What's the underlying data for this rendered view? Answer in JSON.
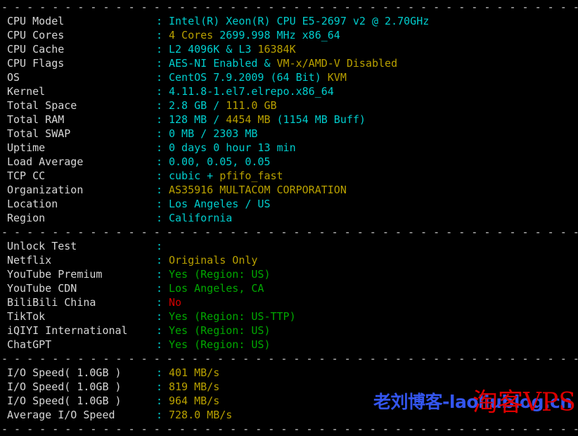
{
  "terminal": {
    "separator_top": "- - - - - - - - - - - - - - - - - - - - - - - - - - - - - - - - - - - - - - - - - - - - - - - - - - - - - - - - - - - - - - - - - - - - - - - - - - - - - - - - - - - -",
    "separator_mid": "- - - - - - - - - - - - - - - - - - - - - - - - - - - - - - - - - - - - - - - - - - - - - - - - - - - - - - - - - - - - - - - - - - - - - - - - - - - - - - - - - - - -",
    "separator_mid2": "- - - - - - - - - - - - - - - - - - - - - - - - - - - - - - - - - - - - - - - - - - - - - - - - - - - - - - - - - - - - - - - - - - - - - - - - - - - - - - - - - - - -",
    "separator_bottom": "- - - - - - - - - - - - - - - - - - - - - - - - - - - - - - - - - - - - - - - - - - - - - - - - - - - - - - - - - - - - - - - - - - - - - - - - - - - - - - - - - - - -",
    "colon": ":"
  },
  "system_info": [
    {
      "label": "CPU Model",
      "parts": [
        {
          "text": "Intel(R) Xeon(R) CPU E5-2697 v2 @ 2.70GHz",
          "color": "cyan"
        }
      ]
    },
    {
      "label": "CPU Cores",
      "parts": [
        {
          "text": "4 Cores ",
          "color": "yellow"
        },
        {
          "text": "2699.998 MHz x86_64",
          "color": "cyan"
        }
      ]
    },
    {
      "label": "CPU Cache",
      "parts": [
        {
          "text": "L2 4096K ",
          "color": "cyan"
        },
        {
          "text": "& ",
          "color": "cyan"
        },
        {
          "text": "L3 ",
          "color": "cyan"
        },
        {
          "text": "16384K",
          "color": "yellow"
        }
      ]
    },
    {
      "label": "CPU Flags",
      "parts": [
        {
          "text": "AES-NI Enabled & ",
          "color": "cyan"
        },
        {
          "text": "VM-x/AMD-V Disabled",
          "color": "yellow"
        }
      ]
    },
    {
      "label": "OS",
      "parts": [
        {
          "text": "CentOS 7.9.2009 (64 Bit) ",
          "color": "cyan"
        },
        {
          "text": "KVM",
          "color": "yellow"
        }
      ]
    },
    {
      "label": "Kernel",
      "parts": [
        {
          "text": "4.11.8-1.el7.elrepo.x86_64",
          "color": "cyan"
        }
      ]
    },
    {
      "label": "Total Space",
      "parts": [
        {
          "text": "2.8 GB / ",
          "color": "cyan"
        },
        {
          "text": "111.0 GB",
          "color": "yellow"
        }
      ]
    },
    {
      "label": "Total RAM",
      "parts": [
        {
          "text": "128 MB / ",
          "color": "cyan"
        },
        {
          "text": "4454 MB ",
          "color": "yellow"
        },
        {
          "text": "(1154 MB Buff)",
          "color": "cyan"
        }
      ]
    },
    {
      "label": "Total SWAP",
      "parts": [
        {
          "text": "0 MB / 2303 MB",
          "color": "cyan"
        }
      ]
    },
    {
      "label": "Uptime",
      "parts": [
        {
          "text": "0 days 0 hour 13 min",
          "color": "cyan"
        }
      ]
    },
    {
      "label": "Load Average",
      "parts": [
        {
          "text": "0.00, 0.05, 0.05",
          "color": "cyan"
        }
      ]
    },
    {
      "label": "TCP CC",
      "parts": [
        {
          "text": "cubic + ",
          "color": "cyan"
        },
        {
          "text": "pfifo_fast",
          "color": "yellow"
        }
      ]
    },
    {
      "label": "Organization",
      "parts": [
        {
          "text": "AS35916 MULTACOM CORPORATION",
          "color": "yellow"
        }
      ]
    },
    {
      "label": "Location",
      "parts": [
        {
          "text": "Los Angeles / US",
          "color": "cyan"
        }
      ]
    },
    {
      "label": "Region",
      "parts": [
        {
          "text": "California",
          "color": "cyan"
        }
      ]
    }
  ],
  "unlock_test": [
    {
      "label": "Unlock Test",
      "parts": [
        {
          "text": "",
          "color": "white"
        }
      ]
    },
    {
      "label": "Netflix",
      "parts": [
        {
          "text": "Originals Only",
          "color": "yellow"
        }
      ]
    },
    {
      "label": "YouTube Premium",
      "parts": [
        {
          "text": "Yes (Region: US)",
          "color": "green"
        }
      ]
    },
    {
      "label": "YouTube CDN",
      "parts": [
        {
          "text": "Los Angeles, CA",
          "color": "green"
        }
      ]
    },
    {
      "label": "BiliBili China",
      "parts": [
        {
          "text": "No",
          "color": "red"
        }
      ]
    },
    {
      "label": "TikTok",
      "parts": [
        {
          "text": "Yes (Region: US-TTP)",
          "color": "green"
        }
      ]
    },
    {
      "label": "iQIYI International",
      "parts": [
        {
          "text": "Yes (Region: US)",
          "color": "green"
        }
      ]
    },
    {
      "label": "ChatGPT",
      "parts": [
        {
          "text": "Yes (Region: US)",
          "color": "green"
        }
      ]
    }
  ],
  "io_speed": [
    {
      "label": "I/O Speed( 1.0GB )",
      "parts": [
        {
          "text": "401 MB/s",
          "color": "yellow"
        }
      ]
    },
    {
      "label": "I/O Speed( 1.0GB )",
      "parts": [
        {
          "text": "819 MB/s",
          "color": "yellow"
        }
      ]
    },
    {
      "label": "I/O Speed( 1.0GB )",
      "parts": [
        {
          "text": "964 MB/s",
          "color": "yellow"
        }
      ]
    },
    {
      "label": "Average I/O Speed",
      "parts": [
        {
          "text": "728.0 MB/s",
          "color": "yellow"
        }
      ]
    }
  ],
  "watermarks": {
    "blue_text": "老刘博客-laoliublog.cn",
    "blue_color": "#3355ee",
    "red_text": "淘客VPS",
    "red_color": "#dd0000"
  }
}
